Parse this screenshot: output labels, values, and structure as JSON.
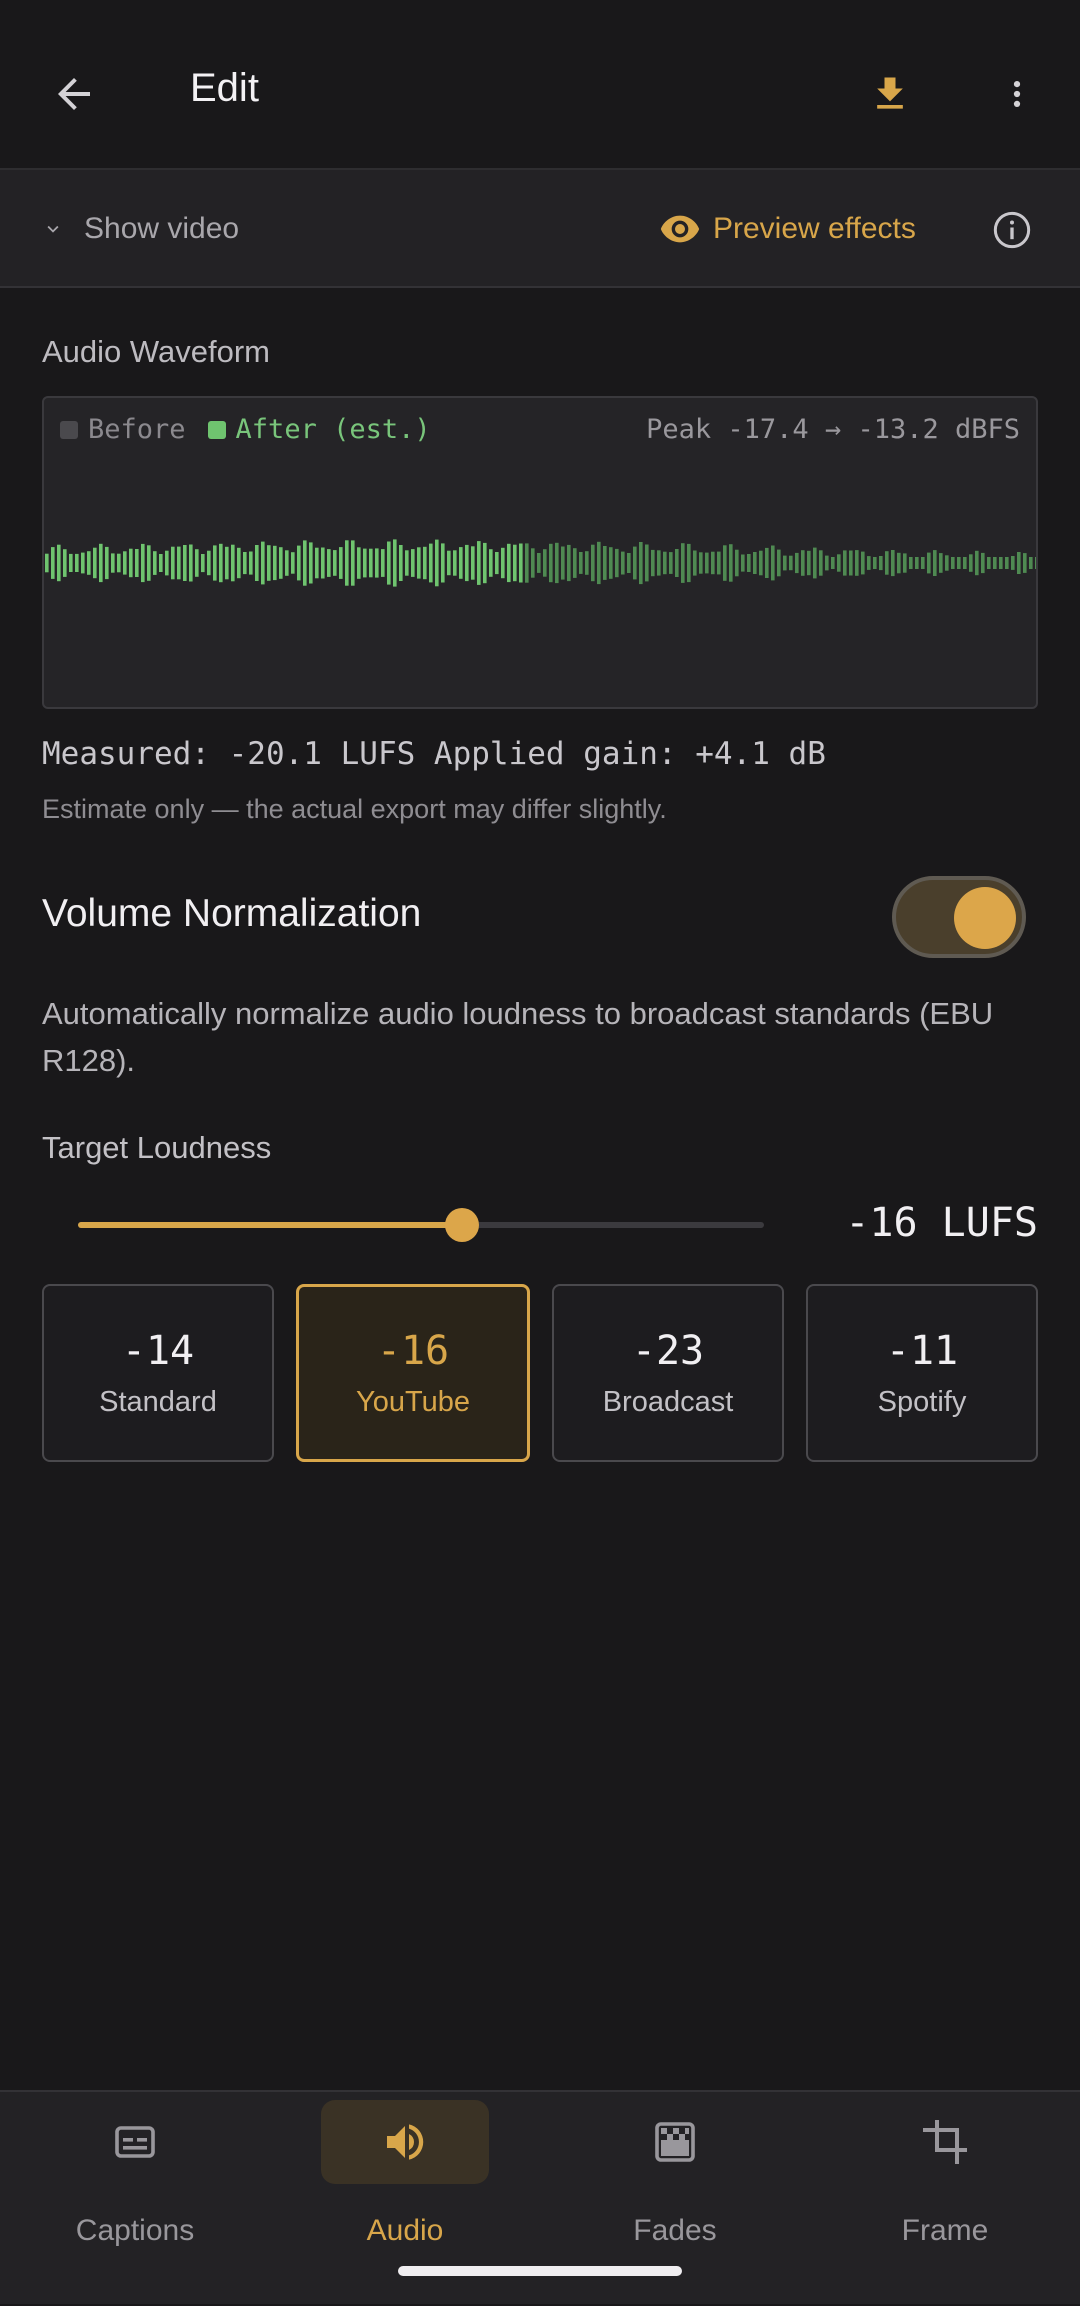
{
  "appbar": {
    "title": "Edit",
    "back_icon": "arrow-left-icon",
    "download_icon": "download-icon",
    "more_icon": "more-vert-icon"
  },
  "strip": {
    "show_video": "Show video",
    "preview_effects": "Preview effects"
  },
  "waveform": {
    "section_label": "Audio Waveform",
    "legend_before": "Before",
    "legend_after": "After (est.)",
    "peak": "Peak -17.4 → -13.2 dBFS",
    "measured": "Measured: -20.1 LUFS  Applied gain: +4.1 dB",
    "estimate_note": "Estimate only — the actual export may differ slightly."
  },
  "normalization": {
    "title": "Volume Normalization",
    "enabled": true,
    "description": "Automatically normalize audio loudness to broadcast standards (EBU R128).",
    "target_label": "Target Loudness",
    "slider_fraction": 0.56,
    "target_value": "-16 LUFS",
    "presets": [
      {
        "value": "-14",
        "name": "Standard",
        "selected": false
      },
      {
        "value": "-16",
        "name": "YouTube",
        "selected": true
      },
      {
        "value": "-23",
        "name": "Broadcast",
        "selected": false
      },
      {
        "value": "-11",
        "name": "Spotify",
        "selected": false
      }
    ]
  },
  "nav": [
    {
      "label": "Captions",
      "icon": "captions-icon",
      "active": false
    },
    {
      "label": "Audio",
      "icon": "volume-icon",
      "active": true
    },
    {
      "label": "Fades",
      "icon": "fades-icon",
      "active": false
    },
    {
      "label": "Frame",
      "icon": "crop-icon",
      "active": false
    }
  ],
  "colors": {
    "accent": "#d8a64a",
    "after_wave": "#6fc46f",
    "background": "#19181a"
  }
}
